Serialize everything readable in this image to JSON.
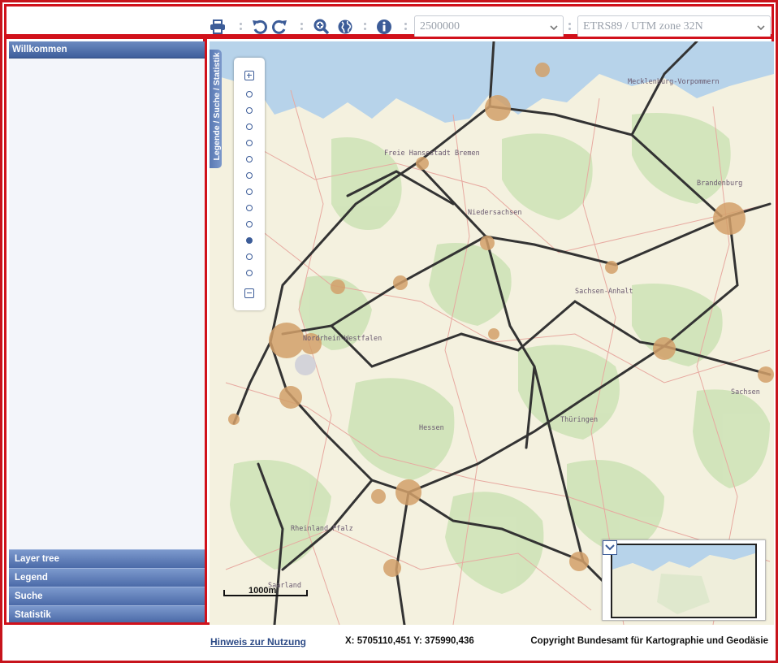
{
  "toolbar": {
    "print_icon": "print-icon",
    "undo_icon": "undo-icon",
    "redo_icon": "redo-icon",
    "zoom_icon": "zoom-in-icon",
    "globe_icon": "globe-icon",
    "info_icon": "info-icon",
    "scale_select": "2500000",
    "crs_select": "ETRS89 / UTM zone 32N"
  },
  "sidebar": {
    "header": "Willkommen",
    "items": [
      {
        "label": "Layer tree"
      },
      {
        "label": "Legend"
      },
      {
        "label": "Suche"
      },
      {
        "label": "Statistik"
      }
    ]
  },
  "map": {
    "side_tab": "Legende / Suche / Statistik",
    "scale_label": "1000m",
    "zoom_levels": 12,
    "active_zoom_index": 9,
    "place_labels": [
      {
        "name": "Freie Hansestadt Bremen"
      },
      {
        "name": "Mecklenburg-Vorpommern"
      },
      {
        "name": "Brandenburg"
      },
      {
        "name": "Niedersachsen"
      },
      {
        "name": "Sachsen-Anhalt"
      },
      {
        "name": "Nordrhein-Westfalen"
      },
      {
        "name": "Sachsen"
      },
      {
        "name": "Hessen"
      },
      {
        "name": "Thüringen"
      },
      {
        "name": "Rheinland-Pfalz"
      },
      {
        "name": "Saarland"
      }
    ]
  },
  "footer": {
    "link": "Hinweis zur Nutzung",
    "coords": "X: 5705110,451 Y: 375990,436",
    "copyright": "Copyright Bundesamt für Kartographie und Geodäsie"
  },
  "colors": {
    "accent": "#3c5c98",
    "frame_red": "#d1111b",
    "map_base": "#f4f1df",
    "forest": "#cfe3b8",
    "water": "#b7d3ea",
    "railway": "#333333",
    "road": "#e7a9a0"
  }
}
